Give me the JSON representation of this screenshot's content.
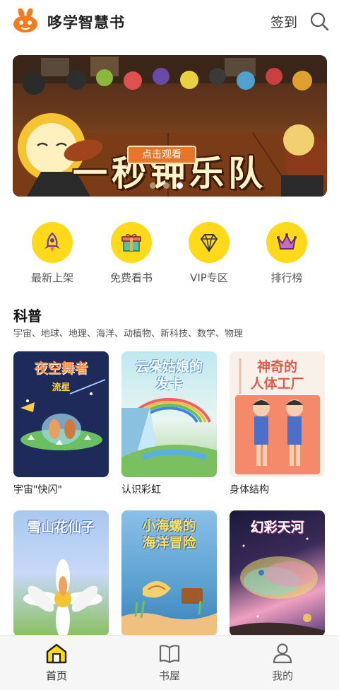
{
  "header": {
    "app_title": "哆学智慧书",
    "signin_label": "签到",
    "search_icon": "search-icon"
  },
  "banner": {
    "title": "一秒钟乐队",
    "button_label": "点击观看",
    "dots": 3,
    "active_dot": 3
  },
  "quick_nav": [
    {
      "label": "最新上架",
      "icon": "rocket-icon"
    },
    {
      "label": "免费看书",
      "icon": "gift-icon"
    },
    {
      "label": "VIP专区",
      "icon": "diamond-icon"
    },
    {
      "label": "排行榜",
      "icon": "crown-icon"
    }
  ],
  "section": {
    "title": "科普",
    "subtitle": "宇宙、地球、地理、海洋、动植物、新科技、数学、物理"
  },
  "books": [
    {
      "cover_title": "夜空舞者",
      "cover_sub": "流星",
      "label": "宇宙\"快闪\""
    },
    {
      "cover_title": "云朵姑娘的\n发卡",
      "label": "认识彩虹"
    },
    {
      "cover_title": "神奇的\n人体工厂",
      "label": "身体结构"
    },
    {
      "cover_title": "雪山花仙子",
      "label": ""
    },
    {
      "cover_title": "小海螺的\n海洋冒险",
      "label": ""
    },
    {
      "cover_title": "幻彩天河",
      "label": ""
    }
  ],
  "tabbar": [
    {
      "label": "首页",
      "icon": "home-icon",
      "active": true
    },
    {
      "label": "书屋",
      "icon": "book-icon",
      "active": false
    },
    {
      "label": "我的",
      "icon": "user-icon",
      "active": false
    }
  ],
  "colors": {
    "accent": "#ffd91a",
    "banner_button": "#e8762a"
  }
}
